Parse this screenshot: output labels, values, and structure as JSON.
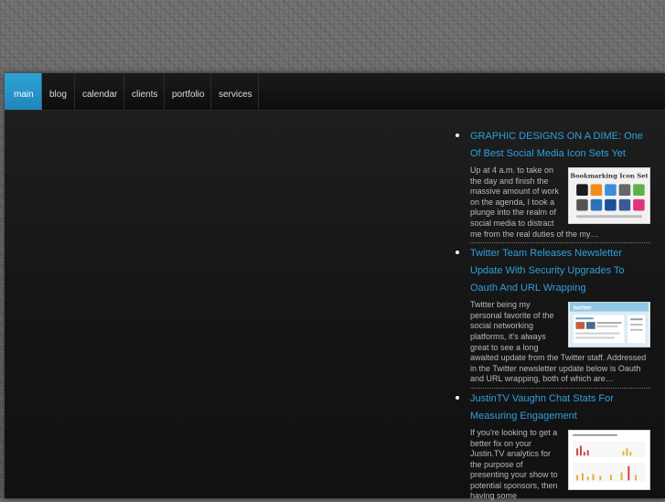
{
  "nav": {
    "items": [
      {
        "label": "main"
      },
      {
        "label": "blog"
      },
      {
        "label": "calendar"
      },
      {
        "label": "clients"
      },
      {
        "label": "portfolio"
      },
      {
        "label": "services"
      }
    ]
  },
  "sidebar": {
    "posts": [
      {
        "title": "GRAPHIC DESIGNS ON A DIME: One Of Best Social Media Icon Sets Yet",
        "excerpt": "Up at 4 a.m. to take on the day and finish the massive amount of work on the agenda, I took a plunge into the realm of social media to distract me from the real duties of the my…",
        "thumb_heading": "Bookmarking Icon Set"
      },
      {
        "title": "Twitter Team Releases Newsletter Update With Security Upgrades To Oauth And URL Wrapping",
        "excerpt": "Twitter being my personal favorite of the social networking platforms, it's always great to see a long awaited update from the Twitter staff. Addressed in the Twitter newsletter update below is Oauth and URL wrapping, both of which are…",
        "thumb_heading": "twitter"
      },
      {
        "title": "JustinTV Vaughn Chat Stats For Measuring Engagement",
        "excerpt": "If you're looking to get a better fix on your Justin.TV analytics for the purpose of presenting your show to potential sponsors, then having some",
        "thumb_heading": ""
      }
    ]
  },
  "colors": {
    "accent": "#2f9fdc",
    "nav_active": "#1f86ba"
  }
}
